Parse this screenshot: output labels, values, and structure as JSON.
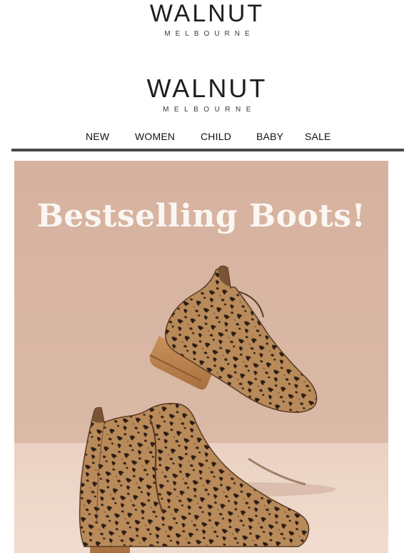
{
  "header": {
    "logo_top": {
      "word": "WALNUT",
      "sub": "MELBOURNE"
    },
    "logo_main": {
      "word": "WALNUT",
      "sub": "MELBOURNE"
    }
  },
  "nav": {
    "items": [
      {
        "label": "NEW"
      },
      {
        "label": "WOMEN"
      },
      {
        "label": "CHILD"
      },
      {
        "label": "BABY"
      },
      {
        "label": "SALE"
      }
    ]
  },
  "hero": {
    "title": "Bestselling Boots!",
    "image_subject": "two leopard-print suede ankle boots",
    "colors": {
      "background": "#d9b7a4",
      "floor": "#e9cdbd",
      "title": "#fbf6f2"
    }
  }
}
